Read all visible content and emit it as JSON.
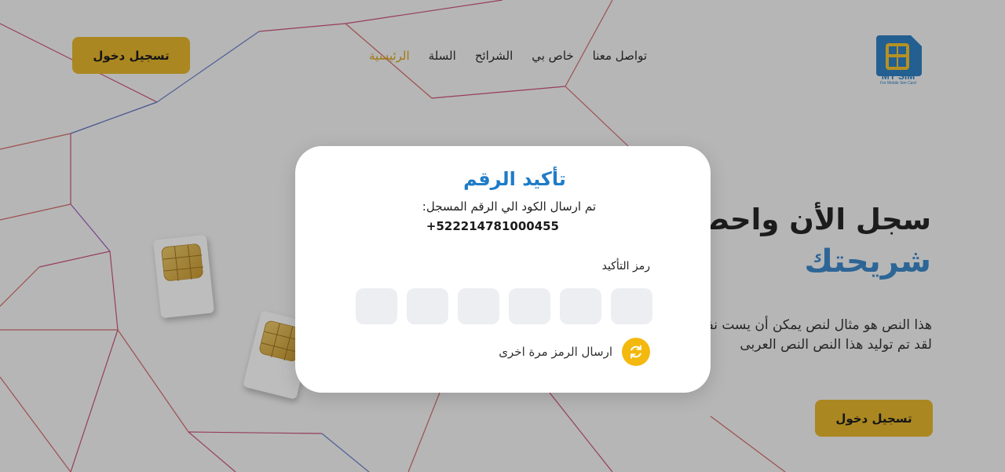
{
  "logo": {
    "title": "MY SIM",
    "subtitle": "For Mobile Sim Card"
  },
  "nav": {
    "items": [
      {
        "label": "الرئيسية",
        "active": true
      },
      {
        "label": "السلة",
        "active": false
      },
      {
        "label": "الشرائح",
        "active": false
      },
      {
        "label": "خاص بي",
        "active": false
      },
      {
        "label": "تواصل معنا",
        "active": false
      }
    ]
  },
  "header": {
    "login_label": "تسجيل دخول"
  },
  "hero": {
    "title": "سجل الأن واحصل",
    "subtitle": "شريحتك",
    "paragraph": "هذا النص هو مثال لنص يمكن أن يست نفس المساحة، لقد تم توليد هذا النص النص العربى",
    "login_label": "تسجيل دخول"
  },
  "modal": {
    "title": "تأكيد الرقم",
    "description": "تم ارسال الكود الي الرقم المسجل:",
    "phone": "+522214781000455",
    "code_label": "رمز التأكيد",
    "code_digits": [
      "",
      "",
      "",
      "",
      "",
      ""
    ],
    "resend_label": "ارسال الرمز مرة اخرى",
    "resend_icon": "refresh-icon"
  },
  "colors": {
    "accent": "#e5b52c",
    "primary": "#1f7cc7",
    "hero_blue": "#3d89c8",
    "resend": "#f3b90f"
  }
}
